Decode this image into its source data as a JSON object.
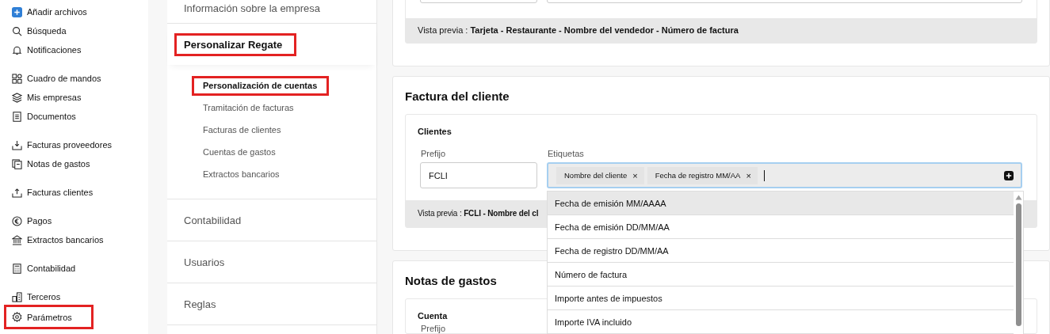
{
  "sidebar": {
    "groups": [
      {
        "items": [
          {
            "label": "Añadir archivos",
            "highlighted": false
          },
          {
            "label": "Búsqueda",
            "highlighted": false
          },
          {
            "label": "Notificaciones",
            "highlighted": false
          }
        ]
      },
      {
        "items": [
          {
            "label": "Cuadro de mandos",
            "highlighted": false
          },
          {
            "label": "Mis empresas",
            "highlighted": false
          },
          {
            "label": "Documentos",
            "highlighted": false
          }
        ]
      },
      {
        "items": [
          {
            "label": "Facturas proveedores",
            "highlighted": false
          },
          {
            "label": "Notas de gastos",
            "highlighted": false
          }
        ]
      },
      {
        "items": [
          {
            "label": "Facturas clientes",
            "highlighted": false
          }
        ]
      },
      {
        "items": [
          {
            "label": "Pagos",
            "highlighted": false
          },
          {
            "label": "Extractos bancarios",
            "highlighted": false
          }
        ]
      },
      {
        "items": [
          {
            "label": "Contabilidad",
            "highlighted": false
          }
        ]
      },
      {
        "items": [
          {
            "label": "Terceros",
            "highlighted": false
          },
          {
            "label": "Parámetros",
            "highlighted": true
          }
        ]
      }
    ]
  },
  "settings_menu": {
    "sections": [
      {
        "label": "Información sobre la empresa",
        "selected": false,
        "highlighted": false
      },
      {
        "label": "Personalizar Regate",
        "selected": true,
        "highlighted": true,
        "children": [
          {
            "label": "Personalización de cuentas",
            "selected": true,
            "highlighted": true
          },
          {
            "label": "Tramitación de facturas",
            "selected": false,
            "highlighted": false
          },
          {
            "label": "Facturas de clientes",
            "selected": false,
            "highlighted": false
          },
          {
            "label": "Cuentas de gastos",
            "selected": false,
            "highlighted": false
          },
          {
            "label": "Extractos bancarios",
            "selected": false,
            "highlighted": false
          }
        ]
      },
      {
        "label": "Contabilidad",
        "selected": false,
        "highlighted": false
      },
      {
        "label": "Usuarios",
        "selected": false,
        "highlighted": false
      },
      {
        "label": "Reglas",
        "selected": false,
        "highlighted": false
      }
    ]
  },
  "top_card": {
    "preview": "Vista previa : **Tarjeta - Restaurante - Nombre del vendedor - Número de factura**"
  },
  "customer_invoice": {
    "title": "Factura del cliente",
    "subtitle": "Clientes",
    "prefix_label": "Prefijo",
    "prefix_value": "FCLI",
    "tags_label": "Etiquetas",
    "tags": [
      {
        "label": "Nombre del cliente",
        "remove": "×"
      },
      {
        "label": "Fecha de registro MM/AA",
        "remove": "×"
      }
    ],
    "preview": "Vista previa : **FCLI - Nombre del cl**",
    "dropdown": [
      {
        "label": "Fecha de emisión MM/AAAA",
        "selected": true
      },
      {
        "label": "Fecha de emisión DD/MM/AA",
        "selected": false
      },
      {
        "label": "Fecha de registro DD/MM/AA",
        "selected": false
      },
      {
        "label": "Número de factura",
        "selected": false
      },
      {
        "label": "Importe antes de impuestos",
        "selected": false
      },
      {
        "label": "Importe IVA incluido",
        "selected": false
      }
    ]
  },
  "expense_notes": {
    "title": "Notas de gastos",
    "subtitle": "Cuenta",
    "prefix_label": "Prefijo"
  }
}
